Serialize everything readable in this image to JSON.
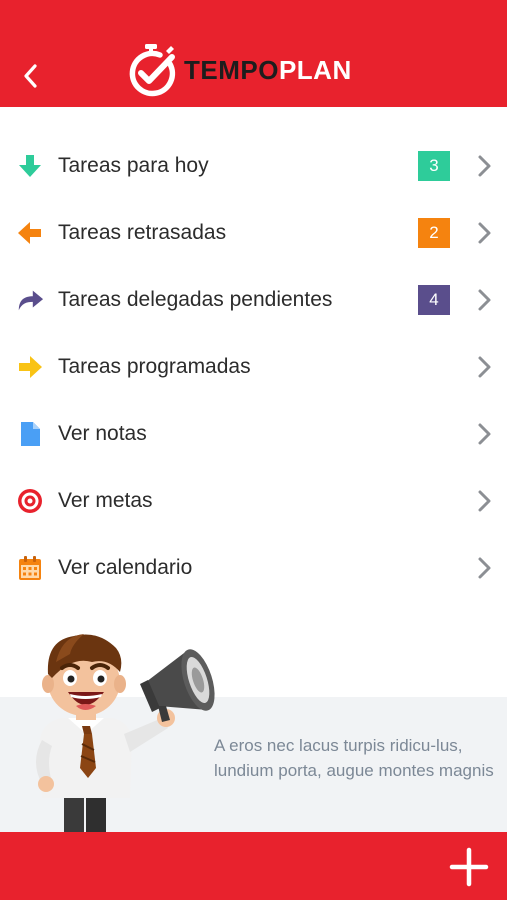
{
  "header": {
    "logo_dark": "TEMPO",
    "logo_light": "PLAN",
    "brand_color": "#e8222d"
  },
  "menu": [
    {
      "label": "Tareas para hoy",
      "icon": "arrow-down-icon",
      "badge": "3",
      "badge_color": "#2ecc9a"
    },
    {
      "label": "Tareas retrasadas",
      "icon": "arrow-left-icon",
      "badge": "2",
      "badge_color": "#f5830f"
    },
    {
      "label": "Tareas delegadas pendientes",
      "icon": "share-arrow-icon",
      "badge": "4",
      "badge_color": "#5a4e8c"
    },
    {
      "label": "Tareas programadas",
      "icon": "arrow-right-icon"
    },
    {
      "label": "Ver notas",
      "icon": "document-icon"
    },
    {
      "label": "Ver metas",
      "icon": "target-icon"
    },
    {
      "label": "Ver calendario",
      "icon": "calendar-icon"
    }
  ],
  "promo": {
    "text": "A eros nec lacus turpis ridicu-lus, lundium porta, augue montes magnis"
  }
}
